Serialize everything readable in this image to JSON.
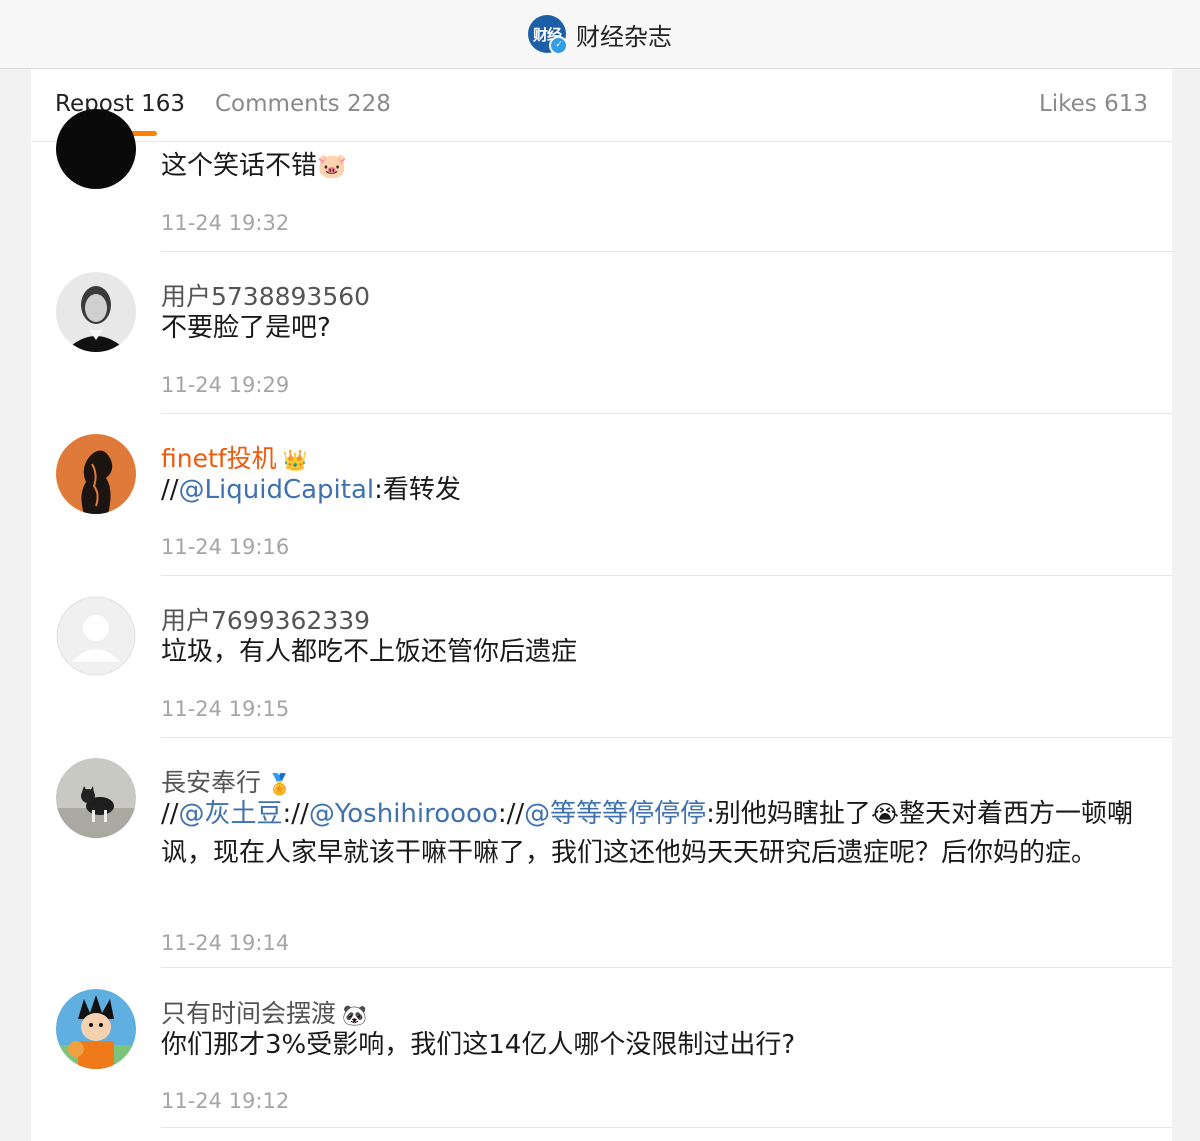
{
  "header": {
    "logo_text": "财经",
    "title": "财经杂志"
  },
  "tabs": {
    "repost": "Repost 163",
    "comments": "Comments 228",
    "likes": "Likes 613"
  },
  "comments": [
    {
      "name": "",
      "text": "这个笑话不错",
      "emoji": "🐷",
      "time": "11-24 19:32"
    },
    {
      "name": "用户5738893560",
      "text": "不要脸了是吧?",
      "time": "11-24 19:29"
    },
    {
      "name": "finetf投机",
      "badge": "👑",
      "mention": "@LiquidCapital",
      "text_prefix": "//",
      "text_suffix": ":看转发",
      "time": "11-24 19:16"
    },
    {
      "name": "用户7699362339",
      "text": "垃圾，有人都吃不上饭还管你后遗症",
      "time": "11-24 19:15"
    },
    {
      "name": "長安奉行",
      "badge": "🏅",
      "m1": "@灰土豆",
      "m2": "@Yoshihiroooo",
      "m3": "@等等等停停停",
      "t_after_m3": ":别他妈瞎扯了",
      "emoji": "😭",
      "t_rest": "整天对着西方一顿嘲讽，现在人家早就该干嘛干嘛了，我们这还他妈天天研究后遗症呢？后你妈的症。",
      "time": "11-24 19:14"
    },
    {
      "name": "只有时间会摆渡",
      "badge": "🐼",
      "text": "你们那才3%受影响，我们这14亿人哪个没限制过出行?",
      "time": "11-24 19:12"
    }
  ],
  "colors": {
    "accent": "#ff8200",
    "link": "#3f72af",
    "vip_name": "#f15a0a"
  }
}
